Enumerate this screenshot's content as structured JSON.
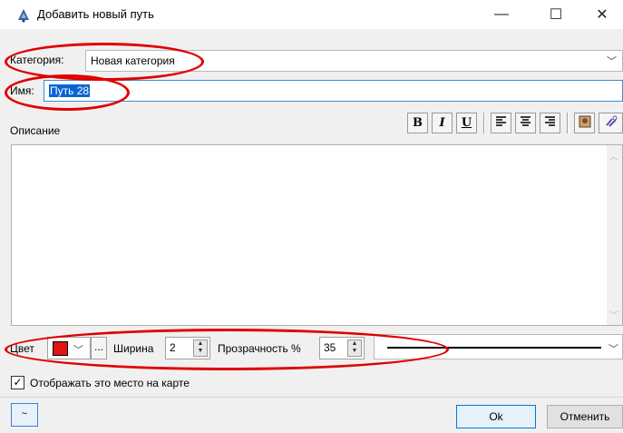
{
  "window": {
    "title": "Добавить новый путь",
    "icon": "app-logo-icon",
    "controls": {
      "minimize": "—",
      "maximize": "☐",
      "close": "✕"
    }
  },
  "category": {
    "label": "Категория:",
    "value": "Новая категория"
  },
  "name": {
    "label": "Имя:",
    "value": "Путь 28"
  },
  "description": {
    "label": "Описание",
    "value": "",
    "toolbar": {
      "bold": "B",
      "italic": "I",
      "underline": "U",
      "align_left": "align-left-icon",
      "align_center": "align-center-icon",
      "align_right": "align-right-icon",
      "image": "insert-image-icon",
      "link": "insert-link-icon"
    }
  },
  "style": {
    "color_label": "Цвет",
    "color_value": "#e31414",
    "more_label": "...",
    "width_label": "Ширина",
    "width_value": "2",
    "opacity_label": "Прозрачность %",
    "opacity_value": "35",
    "line_style": "solid"
  },
  "show_on_map": {
    "label": "Отображать это место на карте",
    "checked": true,
    "mark": "✓"
  },
  "buttons": {
    "tilde": "~",
    "ok": "Ok",
    "cancel": "Отменить"
  },
  "colors": {
    "annotation": "#e00000",
    "accent": "#0078d7",
    "selection": "#0a64d2"
  }
}
